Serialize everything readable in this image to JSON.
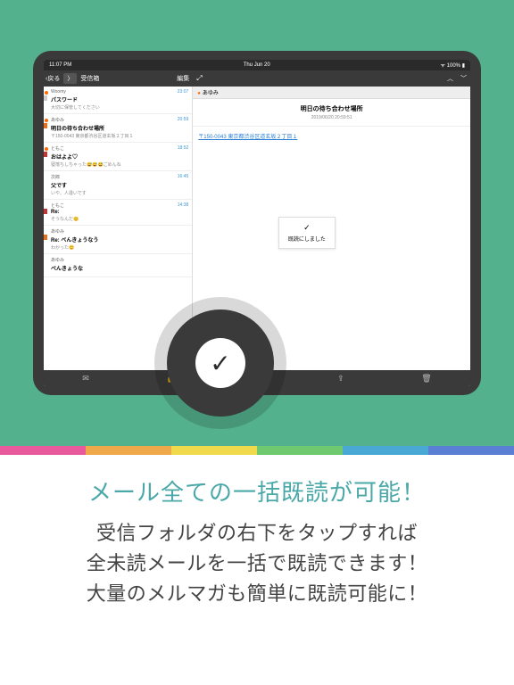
{
  "status": {
    "time": "11:07 PM",
    "date": "Thu Jun 20",
    "wifi": "ᯤ",
    "batt": "100%"
  },
  "nav": {
    "back": "戻る",
    "sub": "〉",
    "title": "受信箱",
    "edit": "編集",
    "expand": "⤢",
    "chevUp": "︿",
    "chevDown": "﹀"
  },
  "list": [
    {
      "badge": "Wo",
      "bc": "b-wo",
      "dot": true,
      "sender": "Woomy",
      "subj": "パスワード",
      "prev": "大切に保管してください",
      "time": "23:07"
    },
    {
      "badge": "au",
      "bc": "b-au",
      "dot": true,
      "sender": "あゆみ",
      "subj": "明日の待ち合わせ場所",
      "prev": "〒150-0043 東京都渋谷区道玄坂２丁目１",
      "time": "20:59"
    },
    {
      "badge": "dc",
      "bc": "b-dc",
      "dot": true,
      "sender": "ともこ",
      "subj": "おはよよ♡",
      "prev": "寝落ちしちゃった😅😅😅ごめんね",
      "time": "18:52"
    },
    {
      "badge": "",
      "bc": "",
      "dot": false,
      "sender": "次郎",
      "subj": "父です",
      "prev": "いや、人違いです",
      "time": "16:45"
    },
    {
      "badge": "dc",
      "bc": "b-dc",
      "dot": false,
      "sender": "ともこ",
      "subj": "Re:",
      "prev": "そうなんだ😊",
      "time": "14:38"
    },
    {
      "badge": "au",
      "bc": "b-au",
      "dot": false,
      "sender": "あゆみ",
      "subj": "Re: べんきょうなう",
      "prev": "わかった😊",
      "time": ""
    },
    {
      "badge": "",
      "bc": "",
      "dot": false,
      "sender": "あゆみ",
      "subj": "べんきょうな",
      "prev": "",
      "time": ""
    }
  ],
  "detail": {
    "tagSender": "あゆみ",
    "title": "明日の待ち合わせ場所",
    "date": "2019/06/20 20:59:51",
    "link": "〒150-0043 東京都渋谷区道玄坂２丁目１"
  },
  "toast": {
    "check": "✓",
    "text": "既読にしました"
  },
  "toolbar": {
    "mail": "✉",
    "lock": "🔓",
    "reply": "↩",
    "share": "⇪",
    "trash": "🗑"
  },
  "bigcheck": "✓",
  "captions": {
    "c1": "メール全ての一括既読が可能！",
    "c2a": "受信フォルダの右下をタップすれば",
    "c2b": "全未読メールを一括で既読できます！",
    "c2c": "大量のメルマガも簡単に既読可能に！"
  }
}
